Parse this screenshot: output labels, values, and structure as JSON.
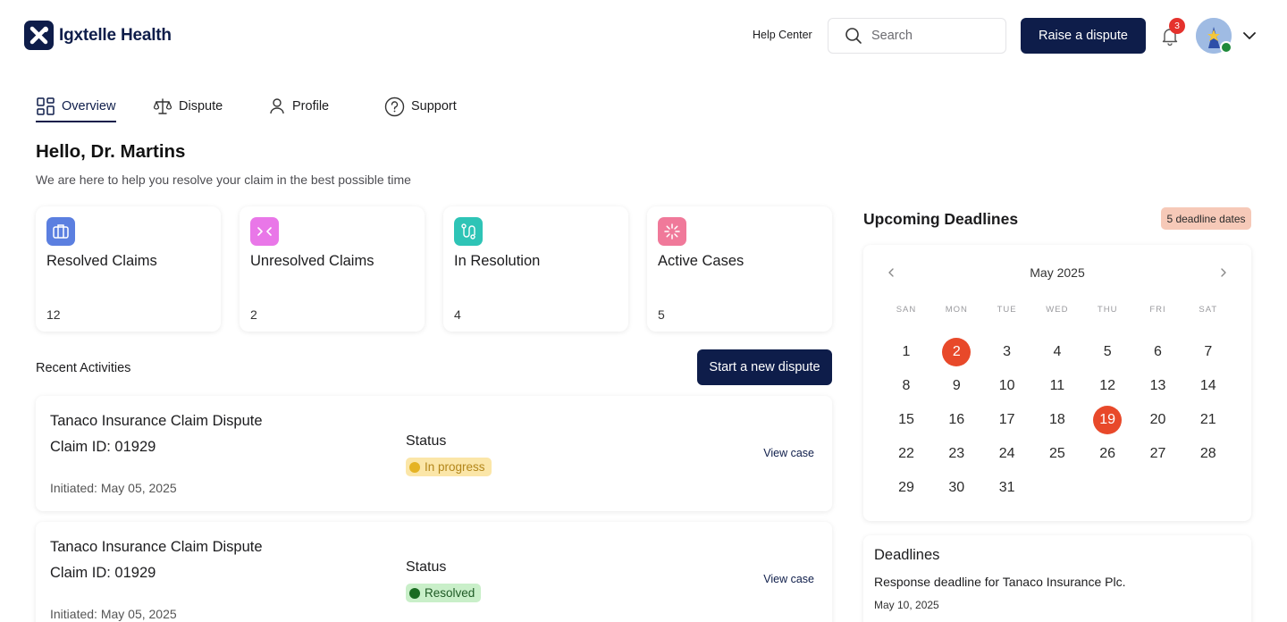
{
  "brand": {
    "name": "Igxtelle Health"
  },
  "header": {
    "help_center": "Help Center",
    "search_placeholder": "Search",
    "raise_dispute": "Raise a dispute",
    "notification_count": "3"
  },
  "tabs": [
    {
      "label": "Overview",
      "active": true
    },
    {
      "label": "Dispute"
    },
    {
      "label": "Profile"
    },
    {
      "label": "Support"
    }
  ],
  "greeting": {
    "title": "Hello, Dr. Martins",
    "subtitle": "We are here to help you resolve your claim in the best possible time"
  },
  "stats": [
    {
      "label": "Resolved Claims",
      "value": "12",
      "icon": "briefcase-icon",
      "color": "#5b7fe0"
    },
    {
      "label": "Unresolved Claims",
      "value": "2",
      "icon": "arrows-in-icon",
      "color": "#e977e8"
    },
    {
      "label": "In Resolution",
      "value": "4",
      "icon": "route-icon",
      "color": "#2ec4b6"
    },
    {
      "label": "Active Cases",
      "value": "5",
      "icon": "loader-icon",
      "color": "#f0799a"
    }
  ],
  "recent": {
    "title": "Recent Activities",
    "start_button": "Start a new dispute",
    "items": [
      {
        "title": "Tanaco Insurance Claim Dispute",
        "claim": "Claim ID: 01929",
        "initiated": "Initiated: May 05, 2025",
        "status_label": "Status",
        "status": "In progress",
        "status_bg": "#fbe6a8",
        "status_dot": "#e5b324",
        "status_text": "#b3861a",
        "view": "View case"
      },
      {
        "title": "Tanaco Insurance Claim Dispute",
        "claim": "Claim ID: 01929",
        "initiated": "Initiated: May 05, 2025",
        "status_label": "Status",
        "status": "Resolved",
        "status_bg": "#c9efc9",
        "status_dot": "#1a6b22",
        "status_text": "#1f5a25",
        "view": "View case"
      }
    ]
  },
  "upcoming": {
    "title": "Upcoming Deadlines",
    "badge": "5 deadline dates",
    "calendar": {
      "month": "May 2025",
      "weekdays": [
        "SAN",
        "MON",
        "TUE",
        "WED",
        "THU",
        "FRI",
        "SAT"
      ],
      "weeks": [
        [
          "1",
          "2",
          "3",
          "4",
          "5",
          "6",
          "7"
        ],
        [
          "8",
          "9",
          "10",
          "11",
          "12",
          "13",
          "14"
        ],
        [
          "15",
          "16",
          "17",
          "18",
          "19",
          "20",
          "21"
        ],
        [
          "22",
          "23",
          "24",
          "25",
          "26",
          "27",
          "28"
        ],
        [
          "29",
          "30",
          "31",
          "",
          "",
          "",
          ""
        ]
      ],
      "highlighted": [
        "2",
        "19"
      ],
      "highlight_color": "#e8492a"
    }
  },
  "deadlines": {
    "title": "Deadlines",
    "items": [
      {
        "desc": "Response deadline for Tanaco Insurance Plc.",
        "date": "May 10, 2025"
      }
    ]
  }
}
